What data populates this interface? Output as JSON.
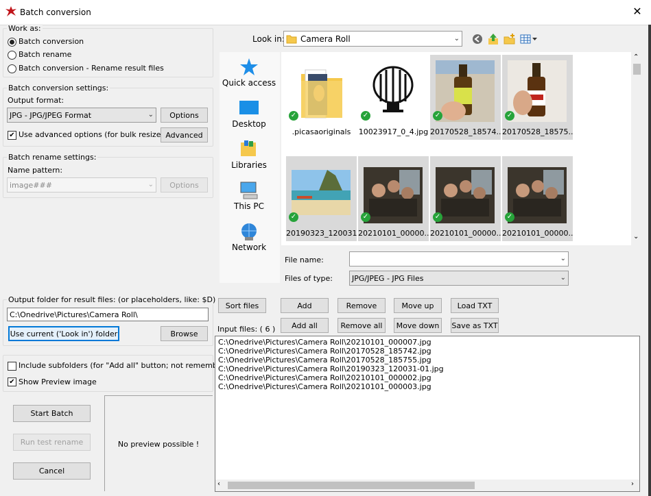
{
  "window": {
    "title": "Batch conversion",
    "close": "✕"
  },
  "work_as": {
    "legend": "Work as:",
    "options": [
      "Batch conversion",
      "Batch rename",
      "Batch conversion - Rename result files"
    ],
    "selected": 0
  },
  "conversion": {
    "legend": "Batch conversion settings:",
    "output_format_label": "Output format:",
    "output_format_value": "JPG - JPG/JPEG Format",
    "options_button": "Options",
    "advanced_check": "Use advanced options (for bulk resize...)",
    "advanced_button": "Advanced"
  },
  "rename": {
    "legend": "Batch rename settings:",
    "name_pattern_label": "Name pattern:",
    "name_pattern_value": "image###",
    "options_button": "Options"
  },
  "output_folder": {
    "legend": "Output folder for result files: (or placeholders, like: $D)",
    "value": "C:\\Onedrive\\Pictures\\Camera Roll\\",
    "use_current_button": "Use current ('Look in') folder",
    "browse_button": "Browse"
  },
  "checks": {
    "include_subfolders": "Include subfolders (for \"Add all\" button; not remembered)",
    "show_preview": "Show Preview image"
  },
  "actions": {
    "start": "Start Batch",
    "test_rename": "Run test rename",
    "cancel": "Cancel"
  },
  "preview_text": "No preview possible !",
  "look_in": {
    "label": "Look in:",
    "value": "Camera Roll"
  },
  "nav": [
    "Quick access",
    "Desktop",
    "Libraries",
    "This PC",
    "Network"
  ],
  "thumbnails": [
    {
      "caption": ".picasaoriginals",
      "kind": "folder",
      "selected": false
    },
    {
      "caption": "10023917_0_4.jpg",
      "kind": "lamp",
      "selected": false
    },
    {
      "caption": "20170528_18574...",
      "kind": "beer1",
      "selected": true
    },
    {
      "caption": "20170528_18575...",
      "kind": "beer2",
      "selected": true
    },
    {
      "caption": "20190323_120031...",
      "kind": "beach",
      "selected": true
    },
    {
      "caption": "20210101_00000...",
      "kind": "party",
      "selected": true
    },
    {
      "caption": "20210101_00000...",
      "kind": "party",
      "selected": true
    },
    {
      "caption": "20210101_00000...",
      "kind": "party",
      "selected": true
    }
  ],
  "file_name": {
    "label": "File name:",
    "value": ""
  },
  "file_type": {
    "label": "Files of type:",
    "value": "JPG/JPEG - JPG Files"
  },
  "list_buttons": {
    "sort": "Sort files",
    "add": "Add",
    "remove": "Remove",
    "move_up": "Move up",
    "load_txt": "Load TXT",
    "add_all": "Add all",
    "remove_all": "Remove all",
    "move_down": "Move down",
    "save_txt": "Save as TXT"
  },
  "input_files": {
    "label": "Input files: ( 6 )",
    "items": [
      "C:\\Onedrive\\Pictures\\Camera Roll\\20210101_000007.jpg",
      "C:\\Onedrive\\Pictures\\Camera Roll\\20170528_185742.jpg",
      "C:\\Onedrive\\Pictures\\Camera Roll\\20170528_185755.jpg",
      "C:\\Onedrive\\Pictures\\Camera Roll\\20190323_120031-01.jpg",
      "C:\\Onedrive\\Pictures\\Camera Roll\\20210101_000002.jpg",
      "C:\\Onedrive\\Pictures\\Camera Roll\\20210101_000003.jpg"
    ]
  }
}
